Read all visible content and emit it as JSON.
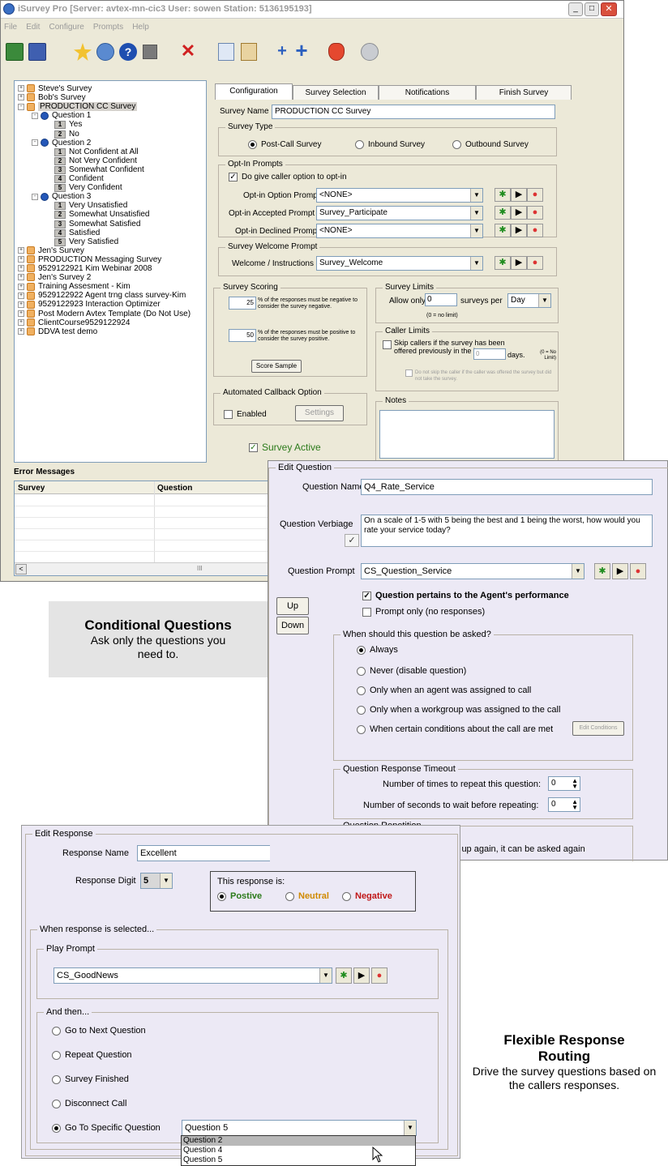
{
  "window": {
    "title": "iSurvey Pro   [Server: avtex-mn-cic3   User: sowen   Station: 5136195193]",
    "menu": [
      "File",
      "Edit",
      "Configure",
      "Prompts",
      "Help"
    ]
  },
  "tree": [
    {
      "label": "Steve's Survey",
      "type": "survey",
      "level": 0,
      "toggle": "+"
    },
    {
      "label": "Bob's Survey",
      "type": "survey",
      "level": 0,
      "toggle": "+"
    },
    {
      "label": "PRODUCTION CC Survey",
      "type": "survey",
      "level": 0,
      "toggle": "-",
      "selected": true
    },
    {
      "label": "Question 1",
      "type": "question",
      "level": 1,
      "toggle": "-"
    },
    {
      "label": "Yes",
      "type": "response",
      "num": "1",
      "level": 2
    },
    {
      "label": "No",
      "type": "response",
      "num": "2",
      "level": 2
    },
    {
      "label": "Question 2",
      "type": "question",
      "level": 1,
      "toggle": "-"
    },
    {
      "label": "Not Confident at All",
      "type": "response",
      "num": "1",
      "level": 2
    },
    {
      "label": "Not Very Confident",
      "type": "response",
      "num": "2",
      "level": 2
    },
    {
      "label": "Somewhat Confident",
      "type": "response",
      "num": "3",
      "level": 2
    },
    {
      "label": "Confident",
      "type": "response",
      "num": "4",
      "level": 2
    },
    {
      "label": "Very Confident",
      "type": "response",
      "num": "5",
      "level": 2
    },
    {
      "label": "Question 3",
      "type": "question",
      "level": 1,
      "toggle": "-"
    },
    {
      "label": "Very Unsatisfied",
      "type": "response",
      "num": "1",
      "level": 2
    },
    {
      "label": "Somewhat Unsatisfied",
      "type": "response",
      "num": "2",
      "level": 2
    },
    {
      "label": "Somewhat Satisfied",
      "type": "response",
      "num": "3",
      "level": 2
    },
    {
      "label": "Satisfied",
      "type": "response",
      "num": "4",
      "level": 2
    },
    {
      "label": "Very Satisfied",
      "type": "response",
      "num": "5",
      "level": 2
    },
    {
      "label": "Jen's Survey",
      "type": "survey",
      "level": 0,
      "toggle": "+"
    },
    {
      "label": "PRODUCTION Messaging Survey",
      "type": "survey",
      "level": 0,
      "toggle": "+"
    },
    {
      "label": "9529122921 Kim Webinar 2008",
      "type": "survey",
      "level": 0,
      "toggle": "+"
    },
    {
      "label": "Jen's Survey 2",
      "type": "survey",
      "level": 0,
      "toggle": "+"
    },
    {
      "label": "Training Assesment - Kim",
      "type": "survey",
      "level": 0,
      "toggle": "+"
    },
    {
      "label": "9529122922 Agent trng class survey-Kim",
      "type": "survey",
      "level": 0,
      "toggle": "+"
    },
    {
      "label": "9529122923 Interaction Optimizer",
      "type": "survey",
      "level": 0,
      "toggle": "+"
    },
    {
      "label": "Post Modern Avtex Template (Do Not Use)",
      "type": "survey",
      "level": 0,
      "toggle": "+"
    },
    {
      "label": "ClientCourse9529122924",
      "type": "survey",
      "level": 0,
      "toggle": "+"
    },
    {
      "label": "DDVA test demo",
      "type": "survey",
      "level": 0,
      "toggle": "+"
    }
  ],
  "tabs": [
    "Configuration",
    "Survey Selection",
    "Notifications",
    "Finish Survey"
  ],
  "config": {
    "survey_name_label": "Survey Name",
    "survey_name": "PRODUCTION CC Survey",
    "survey_type_legend": "Survey Type",
    "survey_types": [
      "Post-Call Survey",
      "Inbound Survey",
      "Outbound Survey"
    ],
    "optin_legend": "Opt-In Prompts",
    "optin_check": "Do give caller option to opt-in",
    "optin_rows": [
      {
        "label": "Opt-in Option Prompt",
        "value": "<NONE>"
      },
      {
        "label": "Opt-in Accepted Prompt",
        "value": "Survey_Participate"
      },
      {
        "label": "Opt-in Declined Prompt",
        "value": "<NONE>"
      }
    ],
    "welcome_legend": "Survey Welcome Prompt",
    "welcome_label": "Welcome / Instructions",
    "welcome_value": "Survey_Welcome",
    "scoring_legend": "Survey Scoring",
    "scoring_neg_pct": "25",
    "scoring_neg_text": "% of the responses must be negative to consider the survey negative.",
    "scoring_pos_pct": "50",
    "scoring_pos_text": "% of the responses must be positive to consider the survey positive.",
    "score_sample": "Score Sample",
    "limits_legend": "Survey Limits",
    "allow_only": "Allow only",
    "limits_value": "0",
    "surveys_per": "surveys per",
    "per_value": "Day",
    "no_limit": "(0 = no limit)",
    "caller_legend": "Caller Limits",
    "caller_check": "Skip callers if the survey has been offered previously in the last",
    "caller_days": "0",
    "days": "days.",
    "caller_no_limit": "(0 = No Limit)",
    "caller_sub": "Do not skip the caller if the caller was offered the survey but did not take the survey.",
    "callback_legend": "Automated Callback Option",
    "enabled": "Enabled",
    "settings": "Settings",
    "notes_legend": "Notes",
    "survey_active": "Survey Active"
  },
  "errors": {
    "title": "Error Messages",
    "columns": [
      "Survey",
      "Question"
    ],
    "scroll_mark": "III"
  },
  "edit_question": {
    "legend": "Edit Question",
    "name_label": "Question Name",
    "name_value": "Q4_Rate_Service",
    "verbiage_label": "Question Verbiage",
    "verbiage_value": "On a scale of 1-5 with 5 being the best and 1 being the worst, how would you rate your service today?",
    "prompt_label": "Question Prompt",
    "prompt_value": "CS_Question_Service",
    "agent_check": "Question pertains to the Agent's performance",
    "prompt_only": "Prompt only (no responses)",
    "up": "Up",
    "down": "Down",
    "when_legend": "When should this question be asked?",
    "when_options": [
      "Always",
      "Never (disable question)",
      "Only when an agent was assigned to call",
      "Only when a workgroup was assigned to the call",
      "When certain conditions about the call are met"
    ],
    "edit_conditions": "Edit Conditions",
    "timeout_legend": "Question Response Timeout",
    "repeat_label": "Number of times to repeat this question:",
    "repeat_value": "0",
    "wait_label": "Number of seconds to wait before repeating:",
    "wait_value": "0",
    "repetition_legend": "Question Repetition",
    "repetition_check": "If this question comes up again, it can be asked again"
  },
  "edit_response": {
    "legend": "Edit Response",
    "name_label": "Response Name",
    "name_value": "Excellent",
    "digit_label": "Response Digit",
    "digit_value": "5",
    "this_response_is": "This response is:",
    "positive": "Postive",
    "neutral": "Neutral",
    "negative": "Negative",
    "when_legend": "When response is selected...",
    "play_legend": "Play Prompt",
    "play_value": "CS_GoodNews",
    "then_legend": "And then...",
    "then_options": [
      "Go to Next Question",
      "Repeat Question",
      "Survey Finished",
      "Disconnect Call",
      "Go To Specific Question"
    ],
    "specific_value": "Question 5",
    "dropdown_items": [
      "Question 2",
      "Question 4",
      "Question 5"
    ]
  },
  "captions": {
    "conditional_title": "Conditional Questions",
    "conditional_sub": "Ask only the questions you need to.",
    "flexible_title": "Flexible Response Routing",
    "flexible_sub": "Drive the survey questions based on the callers responses."
  },
  "colors": {
    "panel": "#ece9f5",
    "accent_blue": "#0a246a",
    "positive": "#2b7a1a",
    "neutral": "#d08a00",
    "negative": "#c01818",
    "caption_bg": "#e4e4e4"
  }
}
